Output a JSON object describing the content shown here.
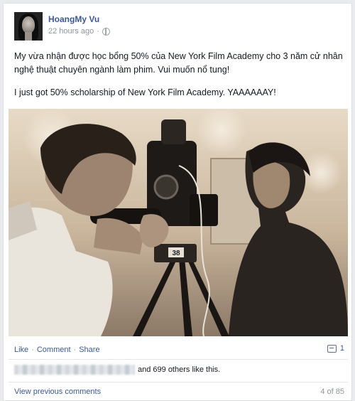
{
  "post": {
    "author": "HoangMy Vu",
    "timestamp": "22 hours ago",
    "privacy_icon": "globe-icon",
    "text_vi": "My vừa nhận được học bổng 50% của New York Film Academy cho 3 năm cử nhân nghệ thuật chuyên ngành làm phim. Vui muốn nổ tung!",
    "text_en": "I just got 50% scholarship of New York Film Academy. YAAAAAAY!",
    "photo": {
      "camera_label": "38"
    }
  },
  "actions": {
    "like": "Like",
    "comment": "Comment",
    "share": "Share",
    "separator": "·",
    "comment_count": "1"
  },
  "likes": {
    "text": "and 699 others like this."
  },
  "comments": {
    "view_previous": "View previous comments",
    "count": "4 of 85"
  },
  "colors": {
    "link": "#3b5998",
    "muted": "#90949c",
    "background": "#e9ebee"
  }
}
